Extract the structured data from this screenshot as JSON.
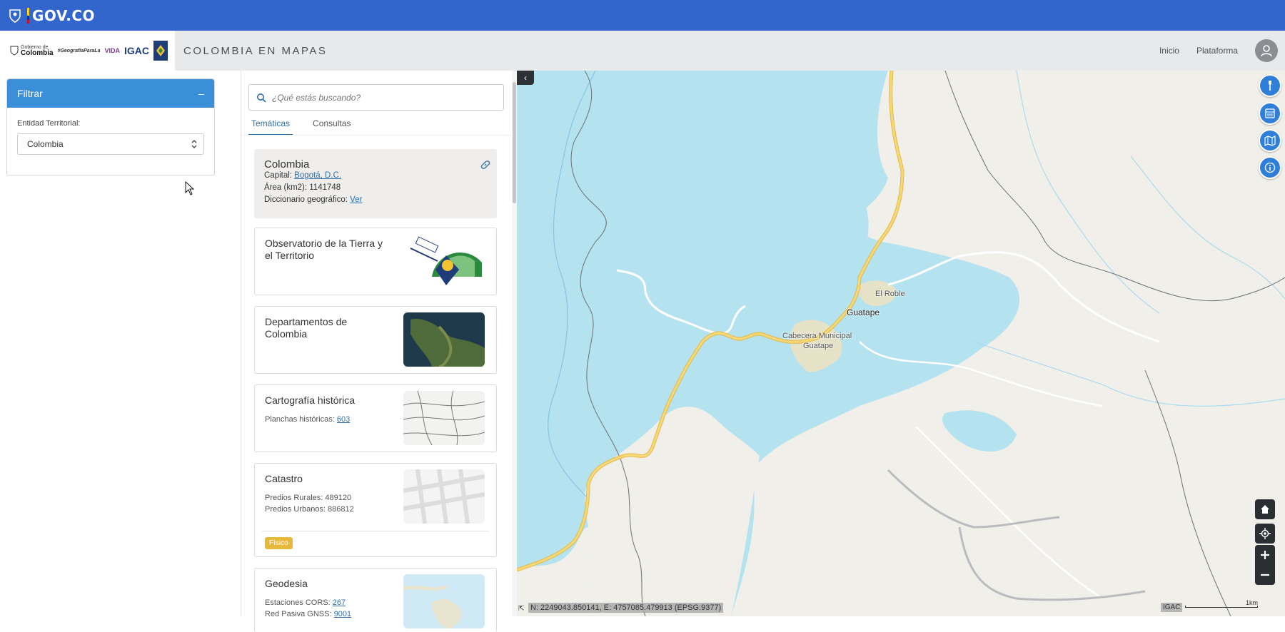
{
  "gov_bar": {
    "label": "GOV.CO"
  },
  "header": {
    "logo_gobierno_small": "Gobierno de",
    "logo_gobierno_big": "Colombia",
    "logo_geografia": "#GeografíaParaLa",
    "logo_vida": "VIDA",
    "logo_igac": "IGAC",
    "app_title": "COLOMBIA EN MAPAS",
    "nav": [
      {
        "label": "Inicio"
      },
      {
        "label": "Plataforma"
      }
    ]
  },
  "filter": {
    "title": "Filtrar",
    "collapse_symbol": "–",
    "entity_label": "Entidad Territorial:",
    "entity_value": "Colombia"
  },
  "search": {
    "placeholder": "¿Qué estás buscando?"
  },
  "tabs": [
    {
      "label": "Temáticas",
      "active": true
    },
    {
      "label": "Consultas",
      "active": false
    }
  ],
  "colombia_card": {
    "title": "Colombia",
    "capital_label": "Capital: ",
    "capital_value": "Bogotá, D.C.",
    "area_label": "Área (km2): ",
    "area_value": "1141748",
    "dict_label": "Diccionario geográfico: ",
    "dict_link": "Ver"
  },
  "cards": [
    {
      "title": "Observatorio de la Tierra y el Territorio"
    },
    {
      "title": "Departamentos de Colombia"
    },
    {
      "title": "Cartografía histórica",
      "line1_label": "Planchas históricas: ",
      "line1_value": "603"
    },
    {
      "title": "Catastro",
      "line1": "Predios Rurales: 489120",
      "line2": "Predios Urbanos: 886812",
      "tag": "Físico"
    },
    {
      "title": "Geodesia",
      "line1_label": "Estaciones CORS: ",
      "line1_value": "267",
      "line2_label": "Red Pasiva GNSS: ",
      "line2_value": "9001"
    }
  ],
  "map": {
    "places": [
      {
        "label": "El Roble"
      },
      {
        "label": "Guatape"
      },
      {
        "label": "Cabecera Municipal"
      },
      {
        "label": "Guatape"
      }
    ],
    "coords": "N: 2249043.850141, E: 4757085.479913 (EPSG:9377)",
    "attribution": "IGAC",
    "scale_label": "1km",
    "collapse_symbol": "‹",
    "colors": {
      "water": "#b4e3ef",
      "land": "#f1efe9",
      "urban": "#e6e2c8",
      "road": "#f2d16b",
      "river": "#88c4df",
      "boundary": "#6b6f73"
    }
  },
  "tool_icons": [
    "tools-icon",
    "layers-icon",
    "map-icon",
    "info-icon"
  ],
  "nav_icons": [
    "home-icon",
    "locate-icon",
    "zoom-in-icon",
    "zoom-out-icon"
  ]
}
